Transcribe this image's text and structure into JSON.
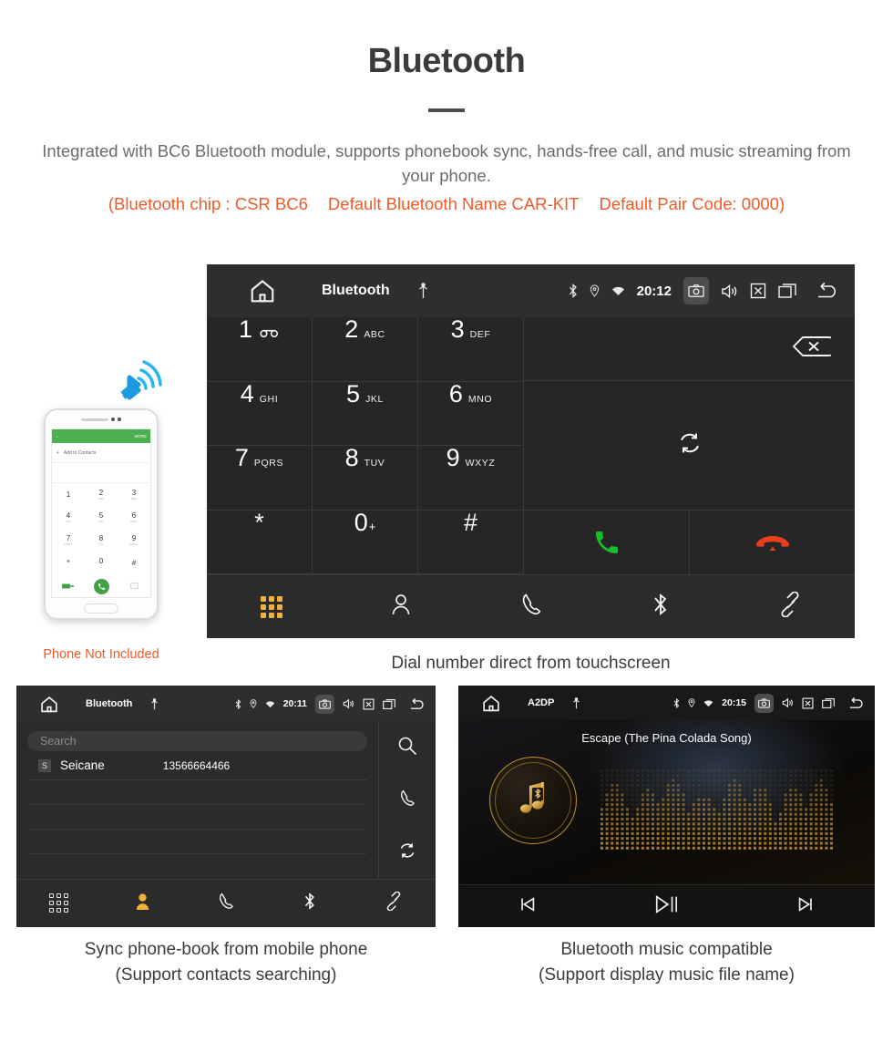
{
  "header": {
    "title": "Bluetooth",
    "description": "Integrated with BC6 Bluetooth module, supports phonebook sync, hands-free call, and music streaming from your phone.",
    "spec_chip": "(Bluetooth chip : CSR BC6",
    "spec_name": "Default Bluetooth Name CAR-KIT",
    "spec_pair": "Default Pair Code: 0000)",
    "accent_color": "#f05a28",
    "text_color": "#6b6b6b"
  },
  "phone_illustration": {
    "caption": "Phone Not Included",
    "appbar_more": "MORE",
    "add_contact": "Add to Contacts",
    "keys": [
      {
        "num": "1",
        "sub": ""
      },
      {
        "num": "2",
        "sub": "ABC"
      },
      {
        "num": "3",
        "sub": "DEF"
      },
      {
        "num": "4",
        "sub": "GHI"
      },
      {
        "num": "5",
        "sub": "JKL"
      },
      {
        "num": "6",
        "sub": "MNO"
      },
      {
        "num": "7",
        "sub": "PQRS"
      },
      {
        "num": "8",
        "sub": "TUV"
      },
      {
        "num": "9",
        "sub": "WXYZ"
      },
      {
        "num": "*",
        "sub": ""
      },
      {
        "num": "0",
        "sub": "+"
      },
      {
        "num": "#",
        "sub": ""
      }
    ]
  },
  "dialer": {
    "statusbar": {
      "title": "Bluetooth",
      "time": "20:12",
      "icons": [
        "home-icon",
        "usb-icon",
        "bluetooth-icon",
        "location-icon",
        "wifi-icon",
        "camera-icon",
        "volume-icon",
        "close-icon",
        "recents-icon",
        "back-icon"
      ]
    },
    "keys": [
      {
        "num": "1",
        "sub": "",
        "voicemail": true
      },
      {
        "num": "2",
        "sub": "ABC"
      },
      {
        "num": "3",
        "sub": "DEF"
      },
      {
        "num": "4",
        "sub": "GHI"
      },
      {
        "num": "5",
        "sub": "JKL"
      },
      {
        "num": "6",
        "sub": "MNO"
      },
      {
        "num": "7",
        "sub": "PQRS"
      },
      {
        "num": "8",
        "sub": "TUV"
      },
      {
        "num": "9",
        "sub": "WXYZ"
      },
      {
        "num": "*",
        "sub": ""
      },
      {
        "num": "0",
        "sub": "+"
      },
      {
        "num": "#",
        "sub": ""
      }
    ],
    "actions": {
      "backspace": "backspace-icon",
      "sync": "sync-icon",
      "call": "call-icon",
      "hangup": "hangup-icon",
      "call_color": "#17c028",
      "hangup_color": "#e8401f"
    },
    "tabs": [
      {
        "name": "dialpad",
        "icon": "dialpad-icon",
        "active": true
      },
      {
        "name": "contacts",
        "icon": "contact-icon",
        "active": false
      },
      {
        "name": "call-log",
        "icon": "handset-icon",
        "active": false
      },
      {
        "name": "bluetooth",
        "icon": "bluetooth-icon",
        "active": false
      },
      {
        "name": "link",
        "icon": "link-icon",
        "active": false
      }
    ],
    "active_tab_color": "#f0b23c",
    "caption": "Dial number direct from touchscreen"
  },
  "phonebook": {
    "statusbar": {
      "title": "Bluetooth",
      "time": "20:11"
    },
    "search_placeholder": "Search",
    "contacts": [
      {
        "initial": "S",
        "name": "Seicane",
        "number": "13566664466"
      }
    ],
    "rail": [
      {
        "name": "search",
        "icon": "search-icon"
      },
      {
        "name": "call",
        "icon": "handset-icon"
      },
      {
        "name": "sync",
        "icon": "sync-icon"
      }
    ],
    "tabs": [
      {
        "name": "dialpad",
        "icon": "dialpad-icon",
        "active": false
      },
      {
        "name": "contacts",
        "icon": "contact-icon",
        "active": true
      },
      {
        "name": "call-log",
        "icon": "handset-icon",
        "active": false
      },
      {
        "name": "bluetooth",
        "icon": "bluetooth-icon",
        "active": false
      },
      {
        "name": "link",
        "icon": "link-icon",
        "active": false
      }
    ],
    "caption_line1": "Sync phone-book from mobile phone",
    "caption_line2": "(Support contacts searching)"
  },
  "music": {
    "statusbar": {
      "title": "A2DP",
      "time": "20:15"
    },
    "track_title": "Escape (The Pina Colada Song)",
    "accent_color": "#c2912e",
    "controls": [
      {
        "name": "previous",
        "icon": "skip-previous-icon"
      },
      {
        "name": "play-pause",
        "icon": "play-pause-icon"
      },
      {
        "name": "next",
        "icon": "skip-next-icon"
      }
    ],
    "caption_line1": "Bluetooth music compatible",
    "caption_line2": "(Support display music file name)"
  }
}
